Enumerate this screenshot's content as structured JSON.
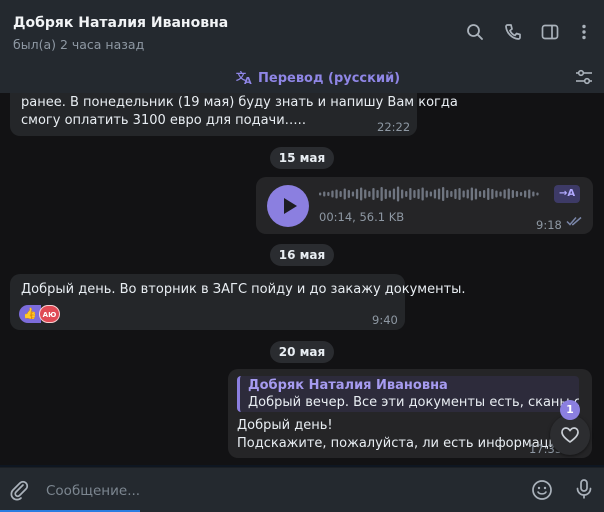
{
  "header": {
    "title": "Добряк Наталия Ивановна",
    "status": "был(а) 2 часа назад",
    "icons": [
      "search-icon",
      "phone-icon",
      "sidebar-toggle-icon",
      "more-vertical-icon"
    ]
  },
  "translate_bar": {
    "label": "Перевод (русский)",
    "icon": "translate-icon",
    "filter_icon": "settings-sliders-icon"
  },
  "messages": [
    {
      "direction": "in",
      "lines": [
        "ранее. В понедельник (19 мая) буду знать  и напишу Вам когда",
        "смогу оплатить 3100 евро для подачи….."
      ],
      "time": "22:22"
    },
    {
      "type": "date",
      "label": "15 мая"
    },
    {
      "direction": "out",
      "type": "voice",
      "meta": "00:14, 56.1 KB",
      "translate_button": "→A",
      "time": "9:18"
    },
    {
      "type": "date",
      "label": "16 мая"
    },
    {
      "direction": "in",
      "text": "Добрый день. Во вторник в ЗАГС пойду и до закажу документы.",
      "reactions": [
        "👍",
        "AЮ"
      ],
      "time": "9:40"
    },
    {
      "type": "date",
      "label": "20 мая"
    },
    {
      "direction": "out",
      "reply": {
        "name": "Добряк Наталия Ивановна",
        "text": "Добрый вечер. Все эти документы есть, сканы скинул"
      },
      "lines": [
        "Добрый день!",
        "Подскажите, пожалуйста, ли есть информация?"
      ],
      "time": "17:35"
    }
  ],
  "floating": {
    "reaction_count": "1",
    "icon": "heart-icon"
  },
  "composer": {
    "placeholder": "Сообщение...",
    "icons": [
      "attach-icon",
      "emoji-icon",
      "microphone-icon"
    ]
  },
  "colors": {
    "accent": "#8b7fe0",
    "header_bg": "#24292f",
    "chat_bg": "#121214",
    "bubble_bg": "#242629"
  }
}
